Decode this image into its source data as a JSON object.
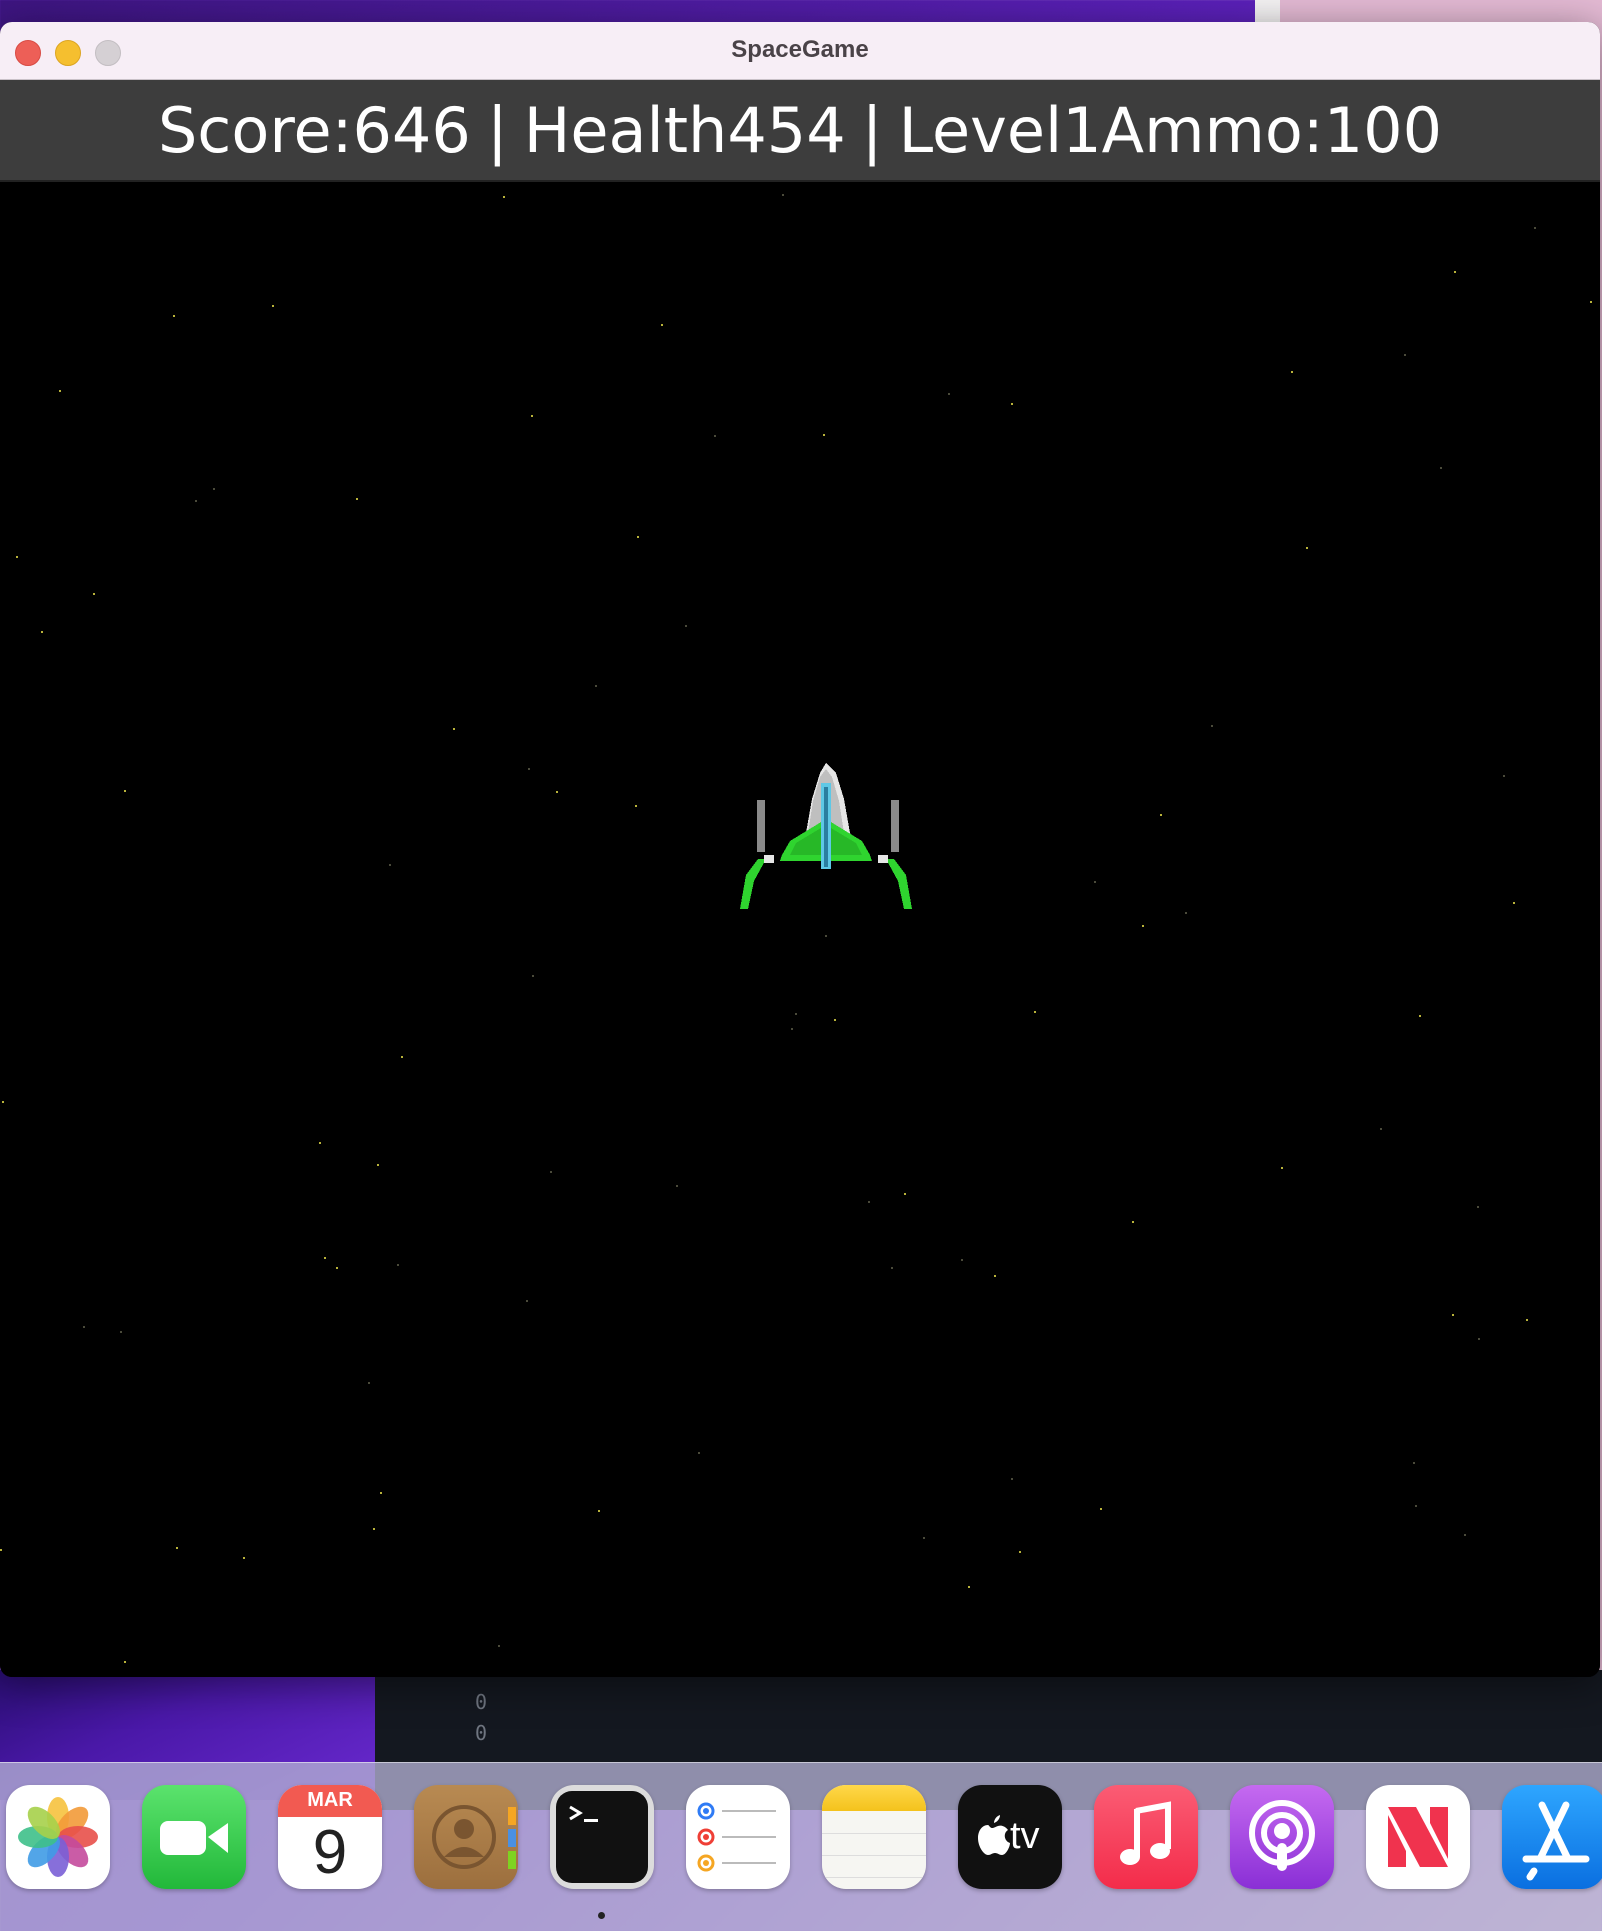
{
  "window": {
    "title": "SpaceGame"
  },
  "hud": {
    "score": "Score:646",
    "health": "Health454",
    "level_ammo": "Level1Ammo:100",
    "separator": "|"
  },
  "terminal_lines": [
    "0",
    "0"
  ],
  "dock": {
    "calendar_month": "MAR",
    "calendar_day": "9",
    "items": [
      "photos-icon",
      "facetime-icon",
      "calendar-icon",
      "contacts-icon",
      "terminal-icon",
      "reminders-icon",
      "notes-icon",
      "apple-tv-icon",
      "music-icon",
      "podcasts-icon",
      "news-icon",
      "app-store-icon"
    ],
    "tv_label": "tv"
  },
  "colors": {
    "hud_background": "#3d3d3d",
    "game_background": "#000000",
    "ship_green": "#2fd42f",
    "ship_cyan": "#5ec8e6",
    "star": "#b8b23a"
  }
}
